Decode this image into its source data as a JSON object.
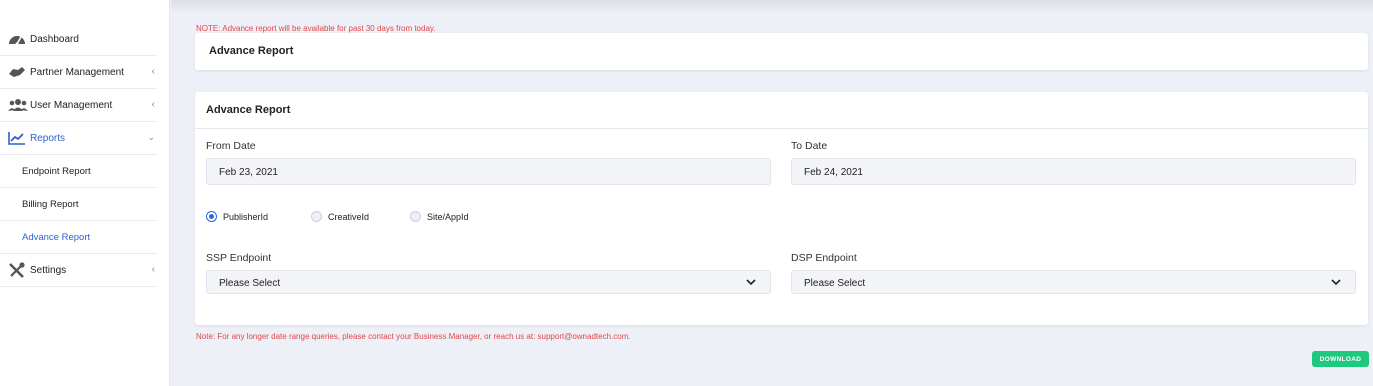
{
  "sidebar": {
    "items": [
      {
        "label": "Dashboard",
        "icon": "speedometer-icon"
      },
      {
        "label": "Partner Management",
        "icon": "handshake-icon"
      },
      {
        "label": "User Management",
        "icon": "users-icon"
      },
      {
        "label": "Reports",
        "icon": "chart-line-icon"
      },
      {
        "label": "Settings",
        "icon": "tools-icon"
      }
    ],
    "sub_items": [
      {
        "label": "Endpoint Report"
      },
      {
        "label": "Billing Report"
      },
      {
        "label": "Advance Report"
      }
    ]
  },
  "notes": {
    "top": "NOTE: Advance report will be available for past 30 days from today.",
    "bottom": "Note: For any longer date range queries, please contact your Business Manager, or reach us at: support@ownadtech.com."
  },
  "header_card": {
    "title": "Advance Report"
  },
  "form": {
    "title": "Advance Report",
    "from_date_label": "From Date",
    "from_date_value": "Feb 23, 2021",
    "to_date_label": "To Date",
    "to_date_value": "Feb 24, 2021",
    "radios": [
      {
        "label": "PublisherId",
        "checked": true
      },
      {
        "label": "CreativeId",
        "checked": false
      },
      {
        "label": "Site/AppId",
        "checked": false
      }
    ],
    "ssp_label": "SSP Endpoint",
    "ssp_value": "Please Select",
    "dsp_label": "DSP Endpoint",
    "dsp_value": "Please Select"
  },
  "download_label": "DOWNLOAD",
  "colors": {
    "accent": "#2f5fd0",
    "note_red": "#e0474c",
    "download_green": "#1ec97e"
  }
}
